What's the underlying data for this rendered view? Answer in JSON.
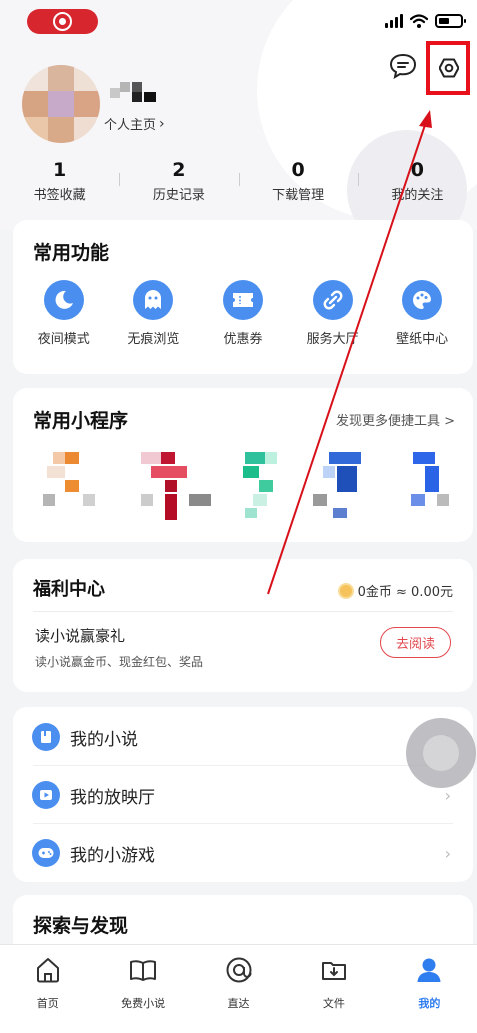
{
  "status_bar": {
    "recording_indicator": "record-icon"
  },
  "header": {
    "message_icon": "message-icon",
    "settings_icon": "settings-icon",
    "highlight_color": "#e8101a"
  },
  "profile": {
    "home_link": "个人主页"
  },
  "stats": [
    {
      "count": "1",
      "label": "书签收藏"
    },
    {
      "count": "2",
      "label": "历史记录"
    },
    {
      "count": "0",
      "label": "下载管理"
    },
    {
      "count": "0",
      "label": "我的关注"
    }
  ],
  "common_functions": {
    "title": "常用功能",
    "items": [
      {
        "label": "夜间模式",
        "icon": "moon-icon"
      },
      {
        "label": "无痕浏览",
        "icon": "ghost-icon"
      },
      {
        "label": "优惠券",
        "icon": "coupon-icon"
      },
      {
        "label": "服务大厅",
        "icon": "service-icon"
      },
      {
        "label": "壁纸中心",
        "icon": "palette-icon"
      }
    ]
  },
  "mini_programs": {
    "title": "常用小程序",
    "more_link": "发现更多便捷工具 >"
  },
  "welfare": {
    "title": "福利中心",
    "coins": "0金币 ≈ 0.00元",
    "task_title": "读小说赢豪礼",
    "task_subtitle": "读小说赢金币、现金红包、奖品",
    "task_button": "去阅读"
  },
  "my_list": [
    {
      "label": "我的小说",
      "icon": "book-icon"
    },
    {
      "label": "我的放映厅",
      "icon": "play-icon"
    },
    {
      "label": "我的小游戏",
      "icon": "gamepad-icon"
    }
  ],
  "explore": {
    "title": "探索与发现"
  },
  "bottom_nav": [
    {
      "label": "首页",
      "icon": "home-icon"
    },
    {
      "label": "免费小说",
      "icon": "open-book-icon"
    },
    {
      "label": "直达",
      "icon": "at-icon"
    },
    {
      "label": "文件",
      "icon": "download-folder-icon"
    },
    {
      "label": "我的",
      "icon": "user-icon",
      "active": true
    }
  ],
  "colors": {
    "accent": "#4a8ff0",
    "active_tab": "#2f7ef0",
    "danger": "#e2474c",
    "annotation": "#d8101a"
  }
}
